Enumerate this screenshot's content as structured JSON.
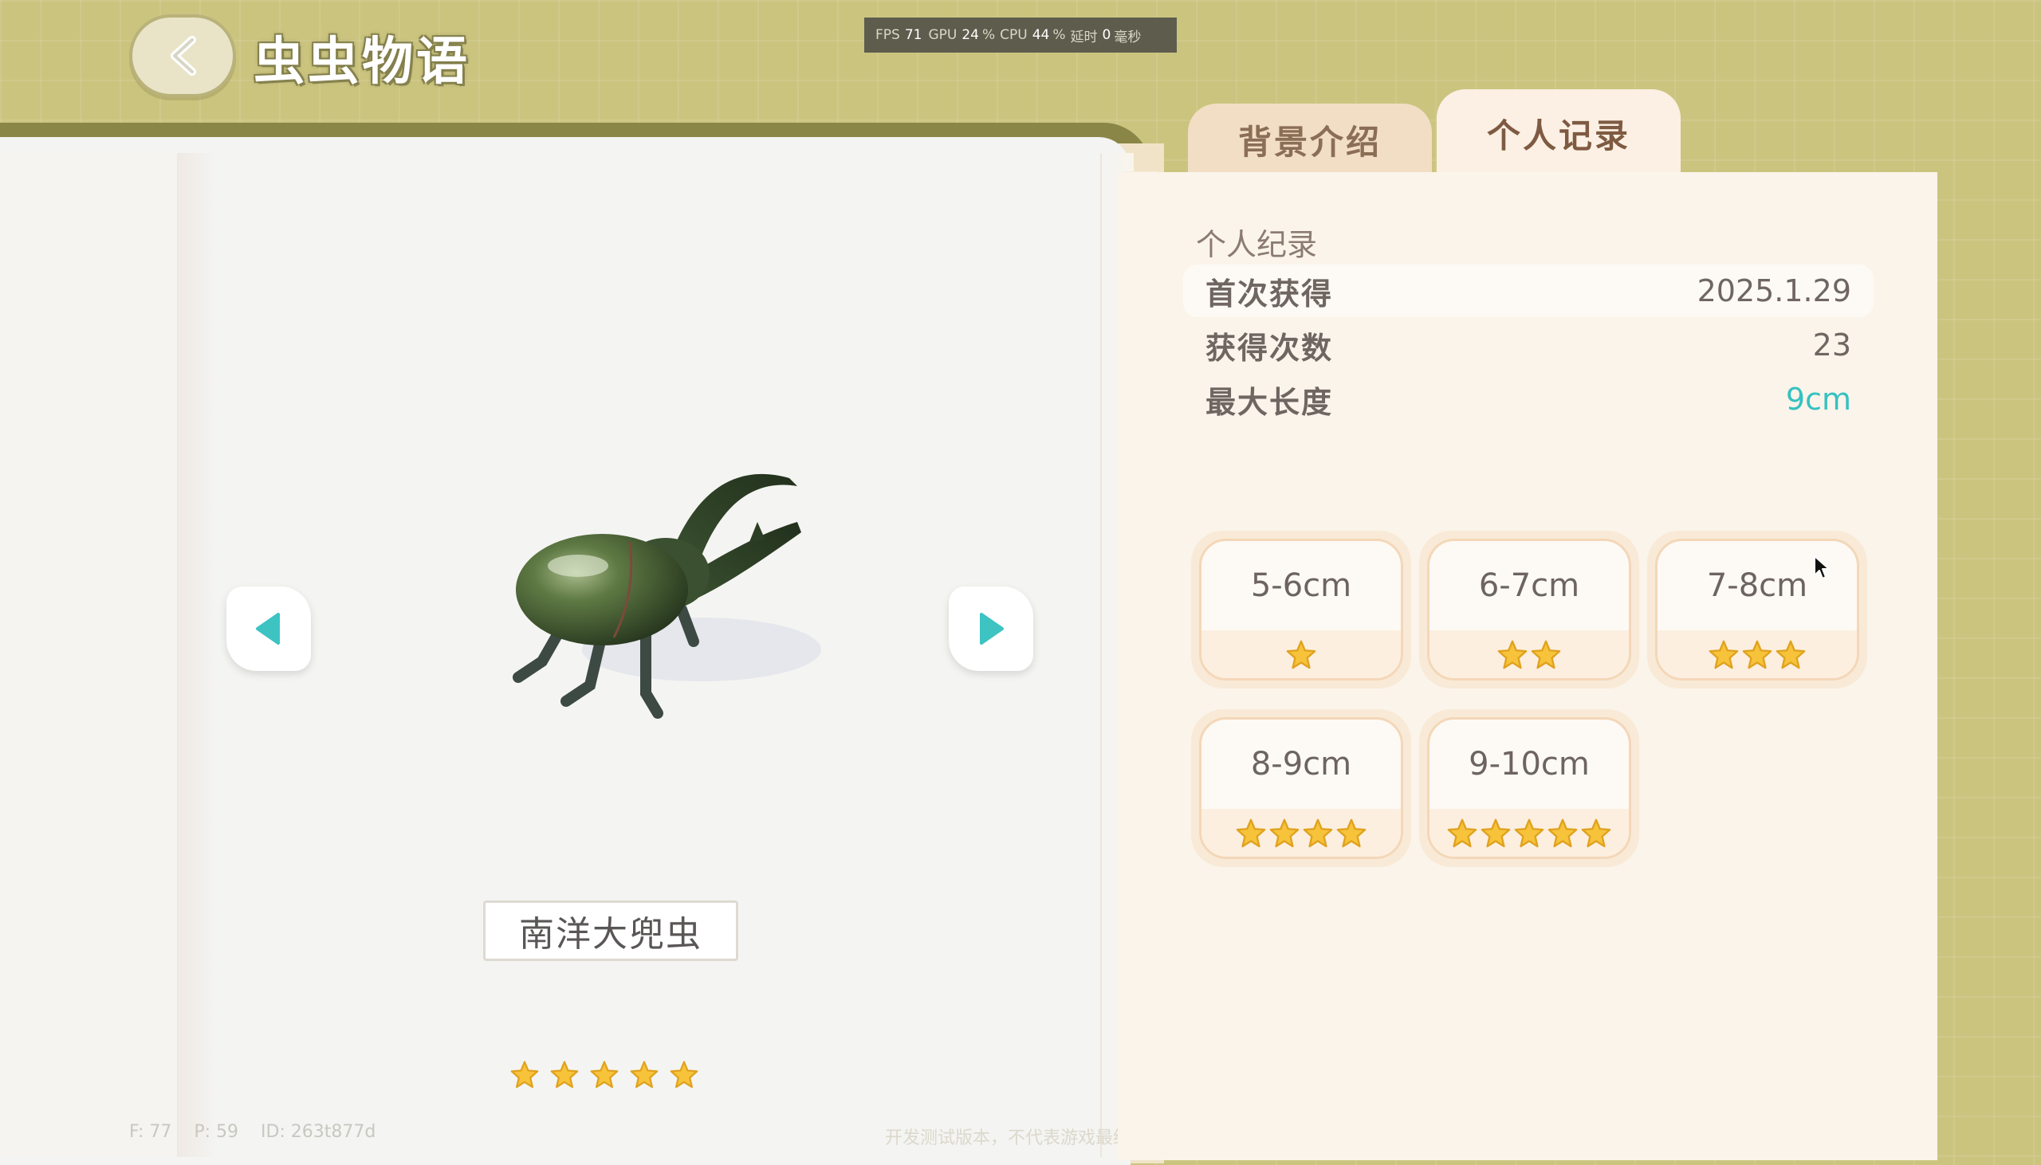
{
  "header": {
    "title": "虫虫物语",
    "back_icon": "chevron-left-icon"
  },
  "perf": {
    "fps_label": "FPS",
    "fps": "71",
    "gpu_label": "GPU",
    "gpu": "24",
    "cpu_label": "CPU",
    "cpu": "44",
    "percent": "%",
    "latency_label": "延时",
    "latency": "0",
    "latency_unit": "毫秒"
  },
  "specimen": {
    "name": "南洋大兜虫",
    "rating": 5,
    "prev_icon": "triangle-left-icon",
    "next_icon": "triangle-right-icon"
  },
  "tabs": [
    {
      "label": "背景介绍",
      "active": false
    },
    {
      "label": "个人记录",
      "active": true
    }
  ],
  "record": {
    "section_title": "个人纪录",
    "rows": [
      {
        "label": "首次获得",
        "value": "2025.1.29"
      },
      {
        "label": "获得次数",
        "value": "23"
      },
      {
        "label": "最大长度",
        "value": "9cm"
      }
    ]
  },
  "size_cards": [
    {
      "range": "5-6cm",
      "stars": 1
    },
    {
      "range": "6-7cm",
      "stars": 2
    },
    {
      "range": "7-8cm",
      "stars": 3
    },
    {
      "range": "8-9cm",
      "stars": 4
    },
    {
      "range": "9-10cm",
      "stars": 5
    }
  ],
  "footer": {
    "ids": "F: 77    P: 59    ID: 263t877d",
    "note": "开发测试版本，不代表游戏最终品质"
  },
  "colors": {
    "background": "#cbc47f",
    "accent_teal": "#35c1c1",
    "star": "#f6c33a"
  }
}
